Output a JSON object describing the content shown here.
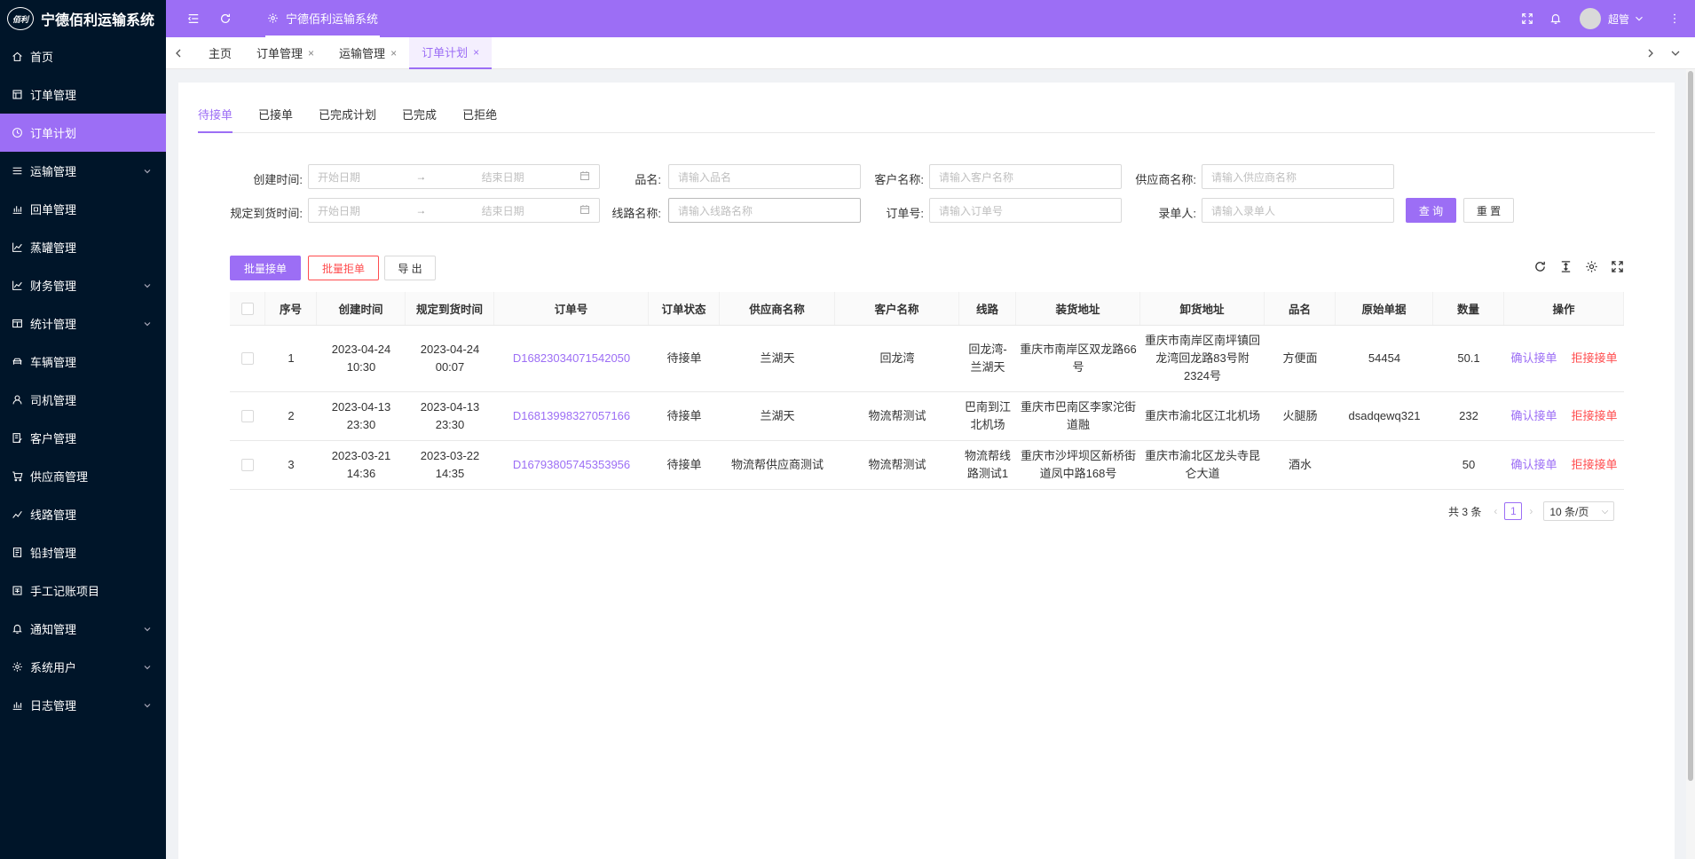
{
  "app": {
    "title": "宁德佰利运输系统",
    "logo_text": "佰利"
  },
  "sidebar": {
    "items": [
      {
        "label": "首页",
        "icon": "home-icon",
        "has_arrow": false,
        "active": false
      },
      {
        "label": "订单管理",
        "icon": "order-icon",
        "has_arrow": false,
        "active": false
      },
      {
        "label": "订单计划",
        "icon": "clock-icon",
        "has_arrow": false,
        "active": true
      },
      {
        "label": "运输管理",
        "icon": "list-icon",
        "has_arrow": true,
        "active": false
      },
      {
        "label": "回单管理",
        "icon": "bar-chart-icon",
        "has_arrow": false,
        "active": false
      },
      {
        "label": "蒸罐管理",
        "icon": "chart-icon",
        "has_arrow": false,
        "active": false
      },
      {
        "label": "财务管理",
        "icon": "chart-icon",
        "has_arrow": true,
        "active": false
      },
      {
        "label": "统计管理",
        "icon": "window-icon",
        "has_arrow": true,
        "active": false
      },
      {
        "label": "车辆管理",
        "icon": "car-icon",
        "has_arrow": false,
        "active": false
      },
      {
        "label": "司机管理",
        "icon": "user-icon",
        "has_arrow": false,
        "active": false
      },
      {
        "label": "客户管理",
        "icon": "edit-icon",
        "has_arrow": false,
        "active": false
      },
      {
        "label": "供应商管理",
        "icon": "cart-icon",
        "has_arrow": false,
        "active": false
      },
      {
        "label": "线路管理",
        "icon": "route-icon",
        "has_arrow": false,
        "active": false
      },
      {
        "label": "铅封管理",
        "icon": "doc-icon",
        "has_arrow": false,
        "active": false
      },
      {
        "label": "手工记账项目",
        "icon": "ledger-icon",
        "has_arrow": false,
        "active": false
      },
      {
        "label": "通知管理",
        "icon": "bell-icon",
        "has_arrow": true,
        "active": false
      },
      {
        "label": "系统用户",
        "icon": "gear-icon",
        "has_arrow": true,
        "active": false
      },
      {
        "label": "日志管理",
        "icon": "bar-chart-icon",
        "has_arrow": true,
        "active": false
      }
    ]
  },
  "header": {
    "title": "宁德佰利运输系统",
    "user_name": "超管"
  },
  "tabs": [
    {
      "label": "主页",
      "closable": false,
      "active": false
    },
    {
      "label": "订单管理",
      "closable": true,
      "active": false
    },
    {
      "label": "运输管理",
      "closable": true,
      "active": false
    },
    {
      "label": "订单计划",
      "closable": true,
      "active": true
    }
  ],
  "sub_tabs": [
    {
      "label": "待接单",
      "active": true
    },
    {
      "label": "已接单",
      "active": false
    },
    {
      "label": "已完成计划",
      "active": false
    },
    {
      "label": "已完成",
      "active": false
    },
    {
      "label": "已拒绝",
      "active": false
    }
  ],
  "filters": {
    "created_time": {
      "label": "创建时间:",
      "start": "开始日期",
      "end": "结束日期"
    },
    "product": {
      "label": "品名:",
      "placeholder": "请输入品名"
    },
    "customer": {
      "label": "客户名称:",
      "placeholder": "请输入客户名称"
    },
    "supplier": {
      "label": "供应商名称:",
      "placeholder": "请输入供应商名称"
    },
    "arrival_time": {
      "label": "规定到货时间:",
      "start": "开始日期",
      "end": "结束日期"
    },
    "route": {
      "label": "线路名称:",
      "placeholder": "请输入线路名称"
    },
    "order_no": {
      "label": "订单号:",
      "placeholder": "请输入订单号"
    },
    "recorder": {
      "label": "录单人:",
      "placeholder": "请输入录单人"
    },
    "query_label": "查 询",
    "reset_label": "重 置"
  },
  "actions": {
    "batch_accept": "批量接单",
    "batch_reject": "批量拒单",
    "export": "导 出"
  },
  "table": {
    "columns": [
      "序号",
      "创建时间",
      "规定到货时间",
      "订单号",
      "订单状态",
      "供应商名称",
      "客户名称",
      "线路",
      "装货地址",
      "卸货地址",
      "品名",
      "原始单据",
      "数量",
      "操作"
    ],
    "rows": [
      {
        "index": "1",
        "created": "2023-04-24 10:30",
        "arrival": "2023-04-24 00:07",
        "order_no": "D16823034071542050",
        "status": "待接单",
        "supplier": "兰湖天",
        "customer": "回龙湾",
        "route": "回龙湾-兰湖天",
        "load_addr": "重庆市南岸区双龙路66号",
        "unload_addr": "重庆市南岸区南坪镇回龙湾回龙路83号附2324号",
        "product": "方便面",
        "original_doc": "54454",
        "quantity": "50.1",
        "confirm": "确认接单",
        "reject": "拒接接单"
      },
      {
        "index": "2",
        "created": "2023-04-13 23:30",
        "arrival": "2023-04-13 23:30",
        "order_no": "D16813998327057166",
        "status": "待接单",
        "supplier": "兰湖天",
        "customer": "物流帮测试",
        "route": "巴南到江北机场",
        "load_addr": "重庆市巴南区李家沱街道融",
        "unload_addr": "重庆市渝北区江北机场",
        "product": "火腿肠",
        "original_doc": "dsadqewq321",
        "quantity": "232",
        "confirm": "确认接单",
        "reject": "拒接接单"
      },
      {
        "index": "3",
        "created": "2023-03-21 14:36",
        "arrival": "2023-03-22 14:35",
        "order_no": "D16793805745353956",
        "status": "待接单",
        "supplier": "物流帮供应商测试",
        "customer": "物流帮测试",
        "route": "物流帮线路测试1",
        "load_addr": "重庆市沙坪坝区新桥街道凤中路168号",
        "unload_addr": "重庆市渝北区龙头寺昆仑大道",
        "product": "酒水",
        "original_doc": "",
        "quantity": "50",
        "confirm": "确认接单",
        "reject": "拒接接单"
      }
    ]
  },
  "pagination": {
    "total_text": "共 3 条",
    "current_page": "1",
    "page_size": "10 条/页"
  },
  "colors": {
    "primary": "#9c6ef5",
    "sidebar_bg": "#001529",
    "danger": "#ff4d4f"
  }
}
